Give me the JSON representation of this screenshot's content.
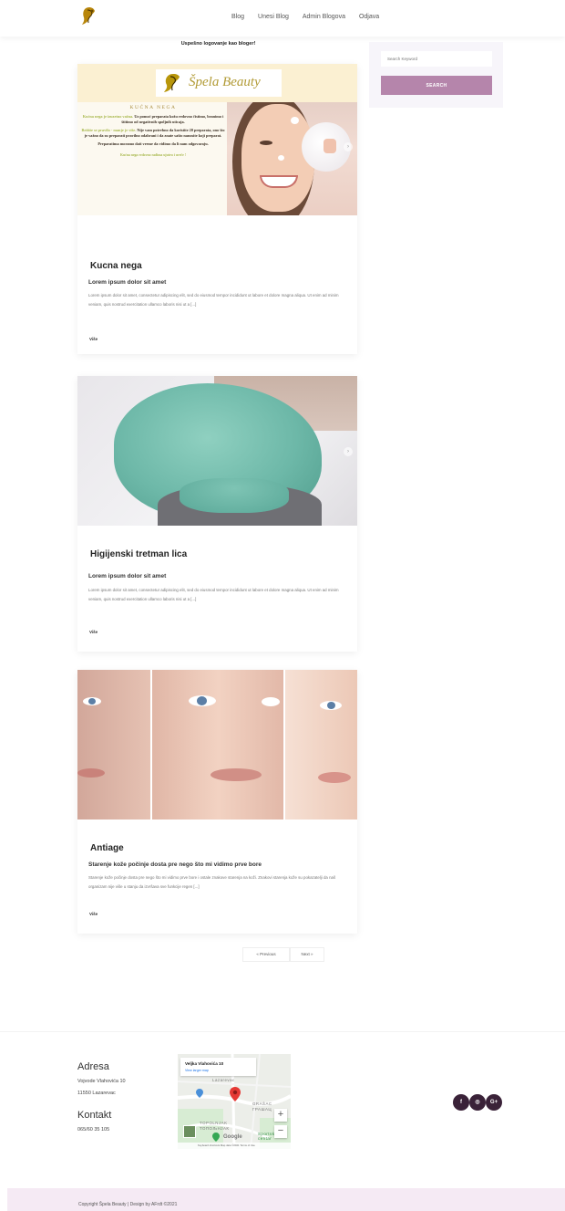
{
  "header": {
    "nav": [
      "Blog",
      "Unesi Blog",
      "Admin Blogova",
      "Odjava"
    ]
  },
  "success_message": "Uspešno logovanje kao bloger!",
  "sidebar": {
    "search_placeholder": "Search Keyword",
    "search_button": "SEARCH"
  },
  "banner": {
    "brand": "Špela Beauty",
    "heading": "KUĆNA NEGA",
    "para1_green": "Kućna nega je izuzetno važna.",
    "para1_dark": "Uz pomoć preparata kožu redovno čistimo, branimo i štitimo od negativnih spoljnih uticaja.",
    "para2_green": "Brižite se pravilo - manje je više.",
    "para2_dark": "Nije vam potrebno da koristite 20 preparata, ono što je važno da su preparati pravilno odabrani i da znate sašto nanosite koji preparat.",
    "para3": "Preparatima moramo dati vreme da vidimo da li nam odgovaraju.",
    "para4": "Kućna nega redovno radima ujutru i uveče !"
  },
  "posts": [
    {
      "title": "Kucna nega",
      "subtitle": "Lorem ipsum dolor sit amet",
      "excerpt": "Lorem ipsum dolor sit amet, consectetur adipiscing elit, sed do eiusmod tempor incididunt ut labore et dolore magna aliqua. Ut enim ad minim veniam, quis nostrud exercitation ullamco laboris nisi ut a [...]",
      "more": "Više"
    },
    {
      "title": "Higijenski tretman lica",
      "subtitle": "Lorem ipsum dolor sit amet",
      "excerpt": "Lorem ipsum dolor sit amet, consectetur adipiscing elit, sed do eiusmod tempor incididunt ut labore et dolore magna aliqua. Ut enim ad minim veniam, quis nostrud exercitation ullamco laboris nisi ut a [...]",
      "more": "Više"
    },
    {
      "title": "Antiage",
      "subtitle": "Starenje kože počinje dosta pre nego što mi vidimo prve bore",
      "excerpt": "Starenje kože počinje dosta pre nego što mi vidimo prve bore i ostale znakove starenja na koži. Znakovi starenja kože su pokazatelji da naš organizam nije više u stanju da izvršava sve funkcije regen [...]",
      "more": "Više"
    }
  ],
  "pagination": {
    "prev": "« Previous",
    "next": "Next »"
  },
  "footer": {
    "address_heading": "Adresa",
    "address_line1": "Vojvode Vlahovića 10",
    "address_line2": "11550 Lazarevac",
    "contact_heading": "Kontakt",
    "phone": "065/60 35 105",
    "map": {
      "address": "Veljka Vlahovića 10",
      "link": "View larger map",
      "place1": "Lazarevac",
      "place2": "TOPOLNJAK",
      "place3": "ТОПОЉНЈАК",
      "place4": "GRAŠAC",
      "place5": "ГРАШАЦ",
      "place6": "Sportski centar",
      "google": "Google",
      "footer": "Keyboard shortcuts   Map data ©2021   Terms of Use"
    },
    "social": [
      "f",
      "◎",
      "G+"
    ],
    "copyright": "Copyright Špela Beauty | Design by AFrdt ©2021"
  }
}
